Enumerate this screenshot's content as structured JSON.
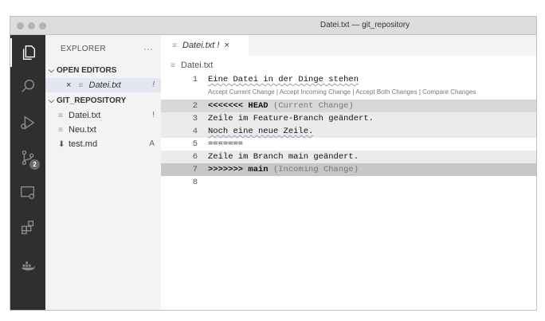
{
  "window": {
    "title": "Datei.txt — git_repository"
  },
  "activity_bar": {
    "scm_badge": "2",
    "icons": [
      "files-icon",
      "search-icon",
      "run-debug-icon",
      "source-control-icon",
      "remote-explorer-icon",
      "extensions-icon",
      "docker-icon"
    ]
  },
  "sidebar": {
    "title": "EXPLORER",
    "more": "···",
    "open_editors_header": "OPEN EDITORS",
    "open_editors": [
      {
        "close": "×",
        "name": "Datei.txt",
        "status": "!"
      }
    ],
    "repo_header": "GIT_REPOSITORY",
    "files": [
      {
        "name": "Datei.txt",
        "status": "!"
      },
      {
        "name": "Neu.txt",
        "status": ""
      },
      {
        "name": "test.md",
        "status": "A"
      }
    ]
  },
  "editor": {
    "tab": {
      "name": "Datei.txt",
      "status": "!",
      "close": "×"
    },
    "breadcrumb": "Datei.txt",
    "codelens": {
      "accept_current": "Accept Current Change",
      "sep": "|",
      "accept_incoming": "Accept Incoming Change",
      "accept_both": "Accept Both Changes",
      "compare": "Compare Changes"
    },
    "lines": [
      {
        "num": "1",
        "text": "Eine Datei in der Dinge stehen"
      },
      {
        "num": "2",
        "marker": "<<<<<<< HEAD",
        "note": "(Current Change)"
      },
      {
        "num": "3",
        "text": "Zeile im Feature-Branch geändert."
      },
      {
        "num": "4",
        "text": "Noch eine neue Zeile."
      },
      {
        "num": "5",
        "text": "======="
      },
      {
        "num": "6",
        "text": "Zeile im Branch main geändert."
      },
      {
        "num": "7",
        "marker": ">>>>>>> main",
        "note": "(Incoming Change)"
      },
      {
        "num": "8",
        "text": ""
      }
    ]
  }
}
